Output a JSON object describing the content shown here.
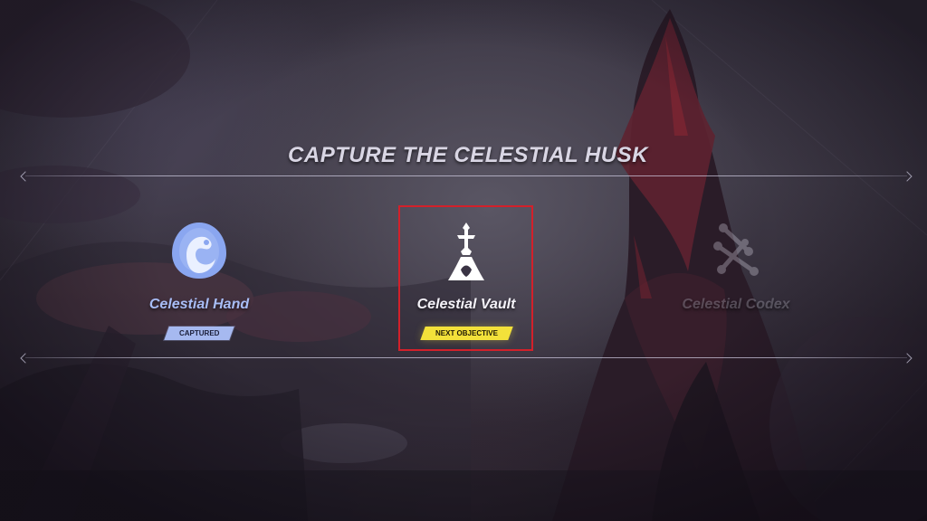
{
  "screen": {
    "title": "CAPTURE THE CELESTIAL HUSK"
  },
  "objectives": [
    {
      "name": "Celestial Hand",
      "status": "CAPTURED",
      "icon": "celestial-hand-icon",
      "color": "#a8bdf6"
    },
    {
      "name": "Celestial Vault",
      "status": "NEXT OBJECTIVE",
      "icon": "celestial-vault-icon",
      "color": "#f4f2f8"
    },
    {
      "name": "Celestial Codex",
      "status": "",
      "icon": "celestial-codex-icon",
      "color": "#dcd8e8"
    }
  ],
  "colors": {
    "captured_badge": "#a6b9f0",
    "next_objective_badge": "#f3e13a",
    "selection_outline": "#d3202a"
  }
}
